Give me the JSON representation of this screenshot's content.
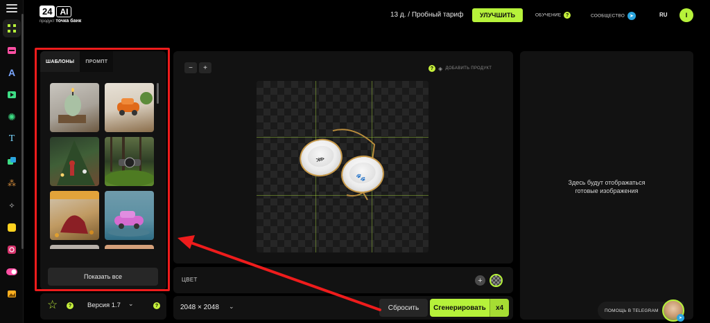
{
  "header": {
    "logo_a": "24",
    "logo_b": "AI",
    "logo_sub_prefix": "продукт",
    "logo_sub_brand": "точка банк",
    "plan_text": "13 д. / Пробный тариф",
    "upgrade_label": "УЛУЧШИТЬ",
    "learning_label": "ОБУЧЕНИЕ",
    "community_label": "СООБЩЕСТВО",
    "language": "RU",
    "user_initial": "I",
    "help_mark": "?"
  },
  "sidebar": {
    "icons": [
      "nodes-icon",
      "layout-icon",
      "text-style-icon",
      "video-icon",
      "openai-icon",
      "text-icon",
      "copy-icon",
      "grid-icon",
      "sparkle-icon",
      "square-icon",
      "instagram-icon",
      "toggle-icon",
      "image-icon"
    ]
  },
  "templates_panel": {
    "tab_templates": "ШАБЛОНЫ",
    "tab_prompt": "ПРОМПТ",
    "show_all_label": "Показать все",
    "thumbnails": [
      "candle",
      "toy-car",
      "christmas-tree",
      "forest-watch",
      "autumn-cake",
      "pink-car",
      "lights",
      "oranges"
    ]
  },
  "version_bar": {
    "label": "Версия 1.7",
    "help_mark": "?"
  },
  "canvas": {
    "zoom_out": "−",
    "zoom_in": "+",
    "help_mark": "?",
    "add_product_label": "ДОБАВИТЬ ПРОДУКТ"
  },
  "color_bar": {
    "label": "ЦВЕТ",
    "add": "+"
  },
  "action_bar": {
    "size_label": "2048 × 2048",
    "reset_label": "Сбросить",
    "generate_label": "Сгенерировать",
    "multiplier": "x4"
  },
  "results_panel": {
    "empty_line1": "Здесь будут отображаться",
    "empty_line2": "готовые изображения"
  },
  "help_widget": {
    "label": "ПОМОЩЬ В TELEGRAM"
  },
  "colors": {
    "accent": "#b6f23a",
    "annotation": "#ee1c1c",
    "panel": "#121212"
  }
}
